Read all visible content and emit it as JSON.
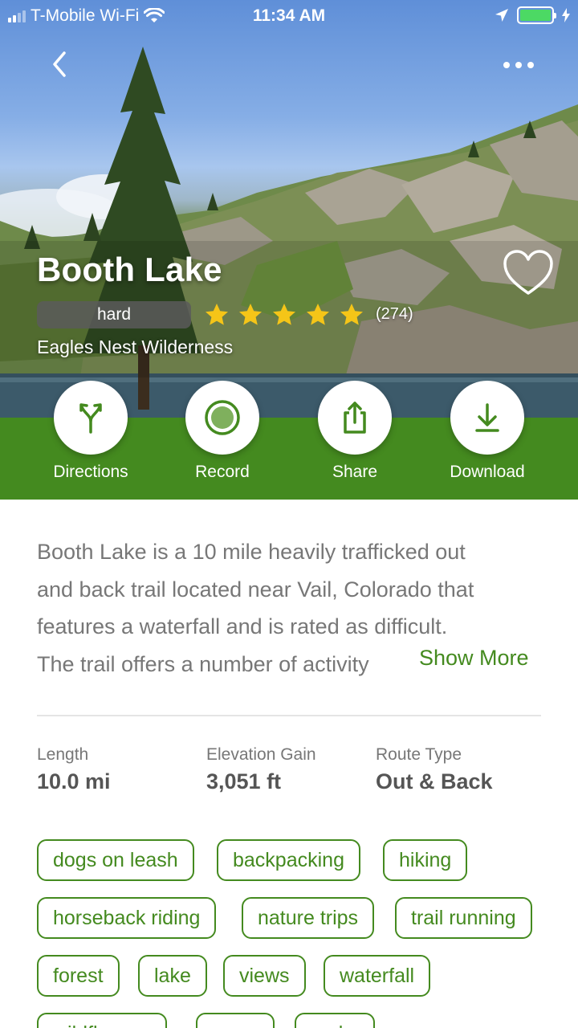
{
  "status_bar": {
    "carrier": "T-Mobile Wi-Fi",
    "time": "11:34 AM"
  },
  "trail": {
    "name": "Booth Lake",
    "difficulty": "hard",
    "rating": 5,
    "review_count": "(274)",
    "area": "Eagles Nest Wilderness"
  },
  "actions": [
    {
      "label": "Directions",
      "icon": "directions-icon"
    },
    {
      "label": "Record",
      "icon": "record-icon"
    },
    {
      "label": "Share",
      "icon": "share-icon"
    },
    {
      "label": "Download",
      "icon": "download-icon"
    }
  ],
  "description": {
    "lines": [
      "Booth Lake is a 10 mile heavily trafficked out",
      "and back trail located near Vail, Colorado that",
      "features a waterfall and is rated as difficult.",
      "The trail offers a number of activity"
    ],
    "show_more": "Show More"
  },
  "stats": [
    {
      "label": "Length",
      "value": "10.0 mi"
    },
    {
      "label": "Elevation Gain",
      "value": "3,051 ft"
    },
    {
      "label": "Route Type",
      "value": "Out & Back"
    }
  ],
  "tags": [
    "dogs on leash",
    "backpacking",
    "hiking",
    "horseback riding",
    "nature trips",
    "trail running",
    "forest",
    "lake",
    "views",
    "waterfall",
    "wildflowers",
    "snow",
    "rocky"
  ],
  "colors": {
    "accent_green": "#448a1f",
    "star_yellow": "#f5c518",
    "badge_gray": "#5a5a5a"
  }
}
